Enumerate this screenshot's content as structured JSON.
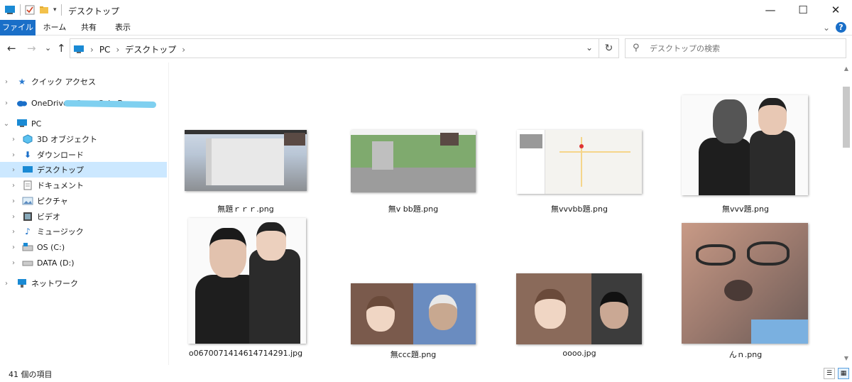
{
  "window": {
    "title": "デスクトップ",
    "controls": {
      "minimize": "—",
      "maximize": "☐",
      "close": "✕"
    }
  },
  "ribbon": {
    "tabs": [
      "ファイル",
      "ホーム",
      "共有",
      "表示"
    ],
    "collapse": "⌄",
    "help": "?"
  },
  "nav": {
    "back": "←",
    "forward": "→",
    "recent": "⌄",
    "up": "↑",
    "breadcrumb": [
      "PC",
      "デスクトップ"
    ],
    "search_placeholder": "デスクトップの検索"
  },
  "sidebar": {
    "items": [
      {
        "label": "クイック アクセス",
        "icon": "star-icon",
        "chevron": "›"
      },
      {
        "label": "OneDrive - Coca-Cola B",
        "icon": "cloud-icon",
        "chevron": "›"
      },
      {
        "label": "PC",
        "icon": "pc-icon",
        "chevron": "⌄"
      },
      {
        "label": "3D オブジェクト",
        "icon": "cube-icon",
        "chevron": "›"
      },
      {
        "label": "ダウンロード",
        "icon": "download-icon",
        "chevron": "›"
      },
      {
        "label": "デスクトップ",
        "icon": "desktop-icon",
        "chevron": "›"
      },
      {
        "label": "ドキュメント",
        "icon": "document-icon",
        "chevron": "›"
      },
      {
        "label": "ピクチャ",
        "icon": "picture-icon",
        "chevron": "›"
      },
      {
        "label": "ビデオ",
        "icon": "video-icon",
        "chevron": "›"
      },
      {
        "label": "ミュージック",
        "icon": "music-icon",
        "chevron": "›"
      },
      {
        "label": "OS (C:)",
        "icon": "drive-icon",
        "chevron": "›"
      },
      {
        "label": "DATA (D:)",
        "icon": "drive-icon",
        "chevron": "›"
      },
      {
        "label": "ネットワーク",
        "icon": "network-icon",
        "chevron": "›"
      }
    ]
  },
  "files": [
    {
      "name": "無題ｒｒｒ.png"
    },
    {
      "name": "無v bb題.png"
    },
    {
      "name": "無vvvbb題.png"
    },
    {
      "name": "無vvv題.png"
    },
    {
      "name": "o0670071414614714291.jpg"
    },
    {
      "name": "無ccc題.png"
    },
    {
      "name": "oooo.jpg"
    },
    {
      "name": "んｎ.png"
    }
  ],
  "status": {
    "item_count": "41 個の項目",
    "view_details": "☰",
    "view_large": "▦"
  }
}
